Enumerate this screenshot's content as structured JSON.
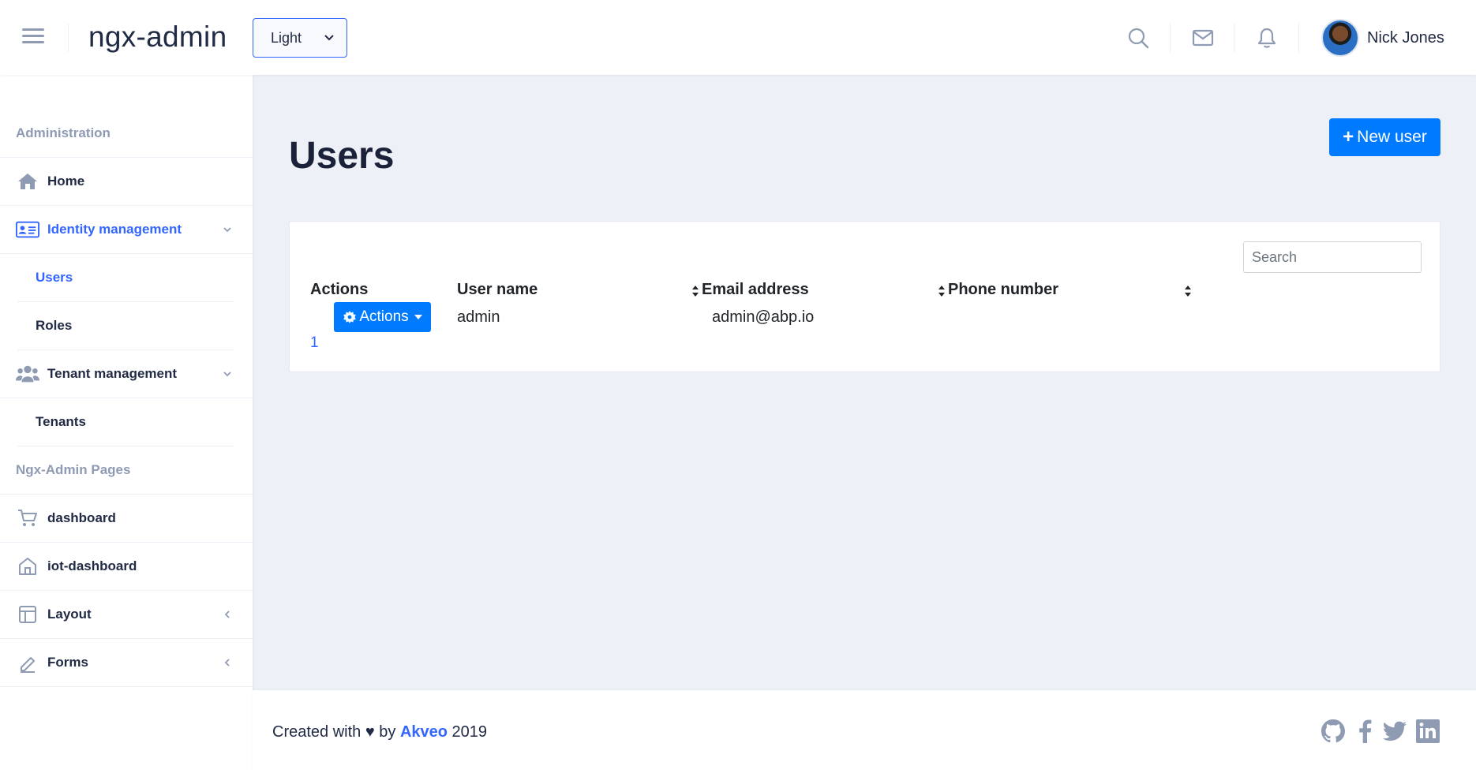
{
  "header": {
    "logo": "ngx-admin",
    "theme_selected": "Light",
    "user_name": "Nick Jones"
  },
  "sidebar": {
    "sections": [
      "Administration",
      "Ngx-Admin Pages"
    ],
    "items": [
      {
        "label": "Home",
        "icon": "home-icon"
      },
      {
        "label": "Identity management",
        "icon": "id-card-icon"
      },
      {
        "label": "Tenant management",
        "icon": "users-icon"
      },
      {
        "label": "dashboard",
        "icon": "shopping-cart-icon"
      },
      {
        "label": "iot-dashboard",
        "icon": "home-outline-icon"
      },
      {
        "label": "Layout",
        "icon": "layout-icon"
      },
      {
        "label": "Forms",
        "icon": "edit-icon"
      }
    ],
    "sub_items": [
      {
        "label": "Users"
      },
      {
        "label": "Roles"
      },
      {
        "label": "Tenants"
      }
    ]
  },
  "main": {
    "title": "Users",
    "new_user_label": "New user",
    "search_placeholder": "Search",
    "columns": [
      "Actions",
      "User name",
      "Email address",
      "Phone number"
    ],
    "rows": [
      {
        "actions_label": "Actions",
        "user_name": "admin",
        "email": "admin@abp.io",
        "phone": ""
      }
    ],
    "page": "1"
  },
  "footer": {
    "prefix": "Created with ♥ by ",
    "brand": "Akveo",
    "year": " 2019"
  },
  "colors": {
    "accent": "#3366ff",
    "primary_button": "#007bff",
    "background": "#edf1f7"
  }
}
